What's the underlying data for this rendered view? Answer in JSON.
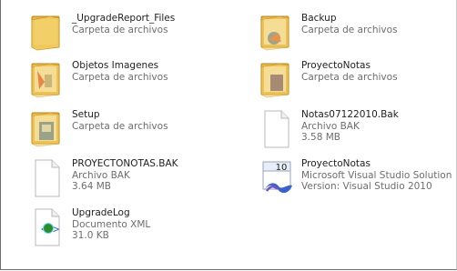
{
  "items": [
    {
      "name": "_UpgradeReport_Files",
      "line1": "Carpeta de archivos",
      "line2": "",
      "icon": "folder-icon"
    },
    {
      "name": "Backup",
      "line1": "Carpeta de archivos",
      "line2": "",
      "icon": "folder-icon"
    },
    {
      "name": "Objetos Imagenes",
      "line1": "Carpeta de archivos",
      "line2": "",
      "icon": "folder-icon"
    },
    {
      "name": "ProyectoNotas",
      "line1": "Carpeta de archivos",
      "line2": "",
      "icon": "folder-icon"
    },
    {
      "name": "Setup",
      "line1": "Carpeta de archivos",
      "line2": "",
      "icon": "folder-icon"
    },
    {
      "name": "Notas07122010.Bak",
      "line1": "Archivo BAK",
      "line2": "3.58 MB",
      "icon": "file-icon"
    },
    {
      "name": "PROYECTONOTAS.BAK",
      "line1": "Archivo BAK",
      "line2": "3.64 MB",
      "icon": "file-icon"
    },
    {
      "name": "ProyectoNotas",
      "line1": "Microsoft Visual Studio Solution",
      "line2": "Version: Visual Studio 2010",
      "icon": "visual-studio-solution-icon",
      "badge": "10"
    },
    {
      "name": "UpgradeLog",
      "line1": "Documento XML",
      "line2": "31.0 KB",
      "icon": "xml-document-icon"
    }
  ]
}
